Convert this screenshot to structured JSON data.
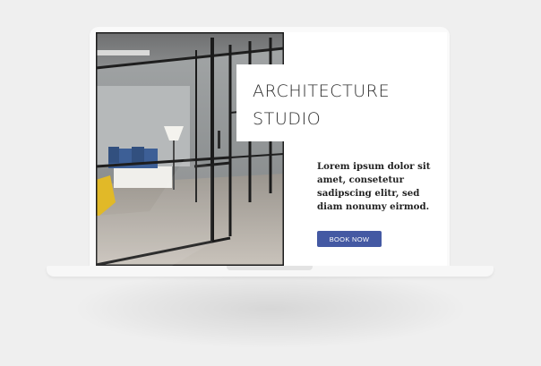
{
  "hero": {
    "title_line_1": "ARCHITECTURE",
    "title_line_2": "STUDIO",
    "body_text": "Lorem ipsum dolor sit amet, consetetur sadipscing elitr, sed diam nonumy eirmod.",
    "button_label": "BOOK NOW"
  },
  "colors": {
    "accent": "#4459a3",
    "background": "#efefef",
    "chair": "#e1b928",
    "sofa": "#3d5f96"
  }
}
